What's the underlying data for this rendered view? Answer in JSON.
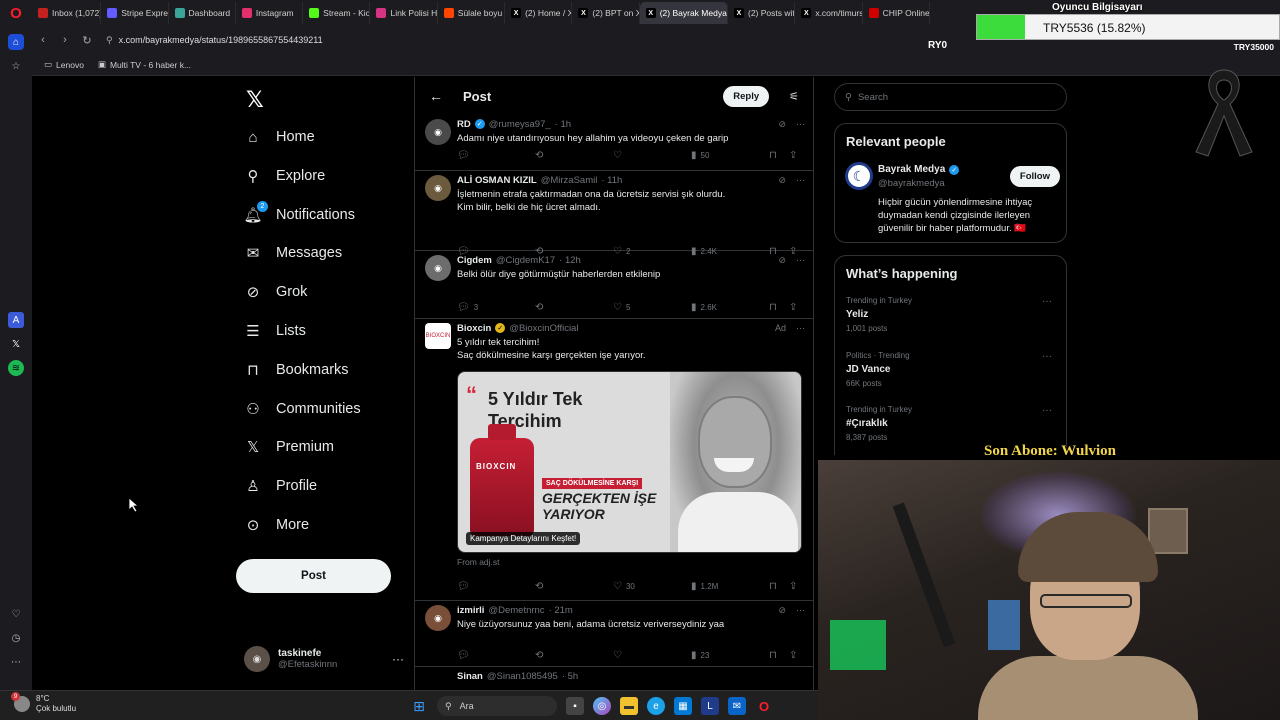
{
  "browser": {
    "tabs": [
      {
        "label": "Inbox (1,072) -",
        "icon": "gmail-icon",
        "color": "#c5221f"
      },
      {
        "label": "Stripe Express",
        "icon": "stripe-icon",
        "color": "#635bff"
      },
      {
        "label": "Dashboard",
        "icon": "dashboard-icon",
        "color": "#3aa39a"
      },
      {
        "label": "Instagram",
        "icon": "instagram-icon",
        "color": "#e1306c"
      },
      {
        "label": "Stream - Kick D",
        "icon": "kick-icon",
        "color": "#53fc18"
      },
      {
        "label": "Link Polisi Hakk",
        "icon": "link-icon",
        "color": "#d63384"
      },
      {
        "label": "Sülale boyu ha",
        "icon": "reddit-icon",
        "color": "#ff4500"
      },
      {
        "label": "(2) Home / X",
        "icon": "x-icon",
        "color": "#000000"
      },
      {
        "label": "(2) BPT on X: \"",
        "icon": "x-icon",
        "color": "#000000"
      },
      {
        "label": "(2) Bayrak Medya on X: \"",
        "icon": "x-icon",
        "color": "#000000"
      },
      {
        "label": "(2) Posts with",
        "icon": "x-icon",
        "color": "#000000"
      },
      {
        "label": "x.com/timursu",
        "icon": "x-icon",
        "color": "#000000"
      },
      {
        "label": "CHIP Online",
        "icon": "chip-icon",
        "color": "#d00000"
      }
    ],
    "active_tab_index": 9,
    "url": "x.com/bayrakmedya/status/1989655867554439211",
    "bookmarks": [
      {
        "label": "Lenovo",
        "icon": "folder-icon"
      },
      {
        "label": "Multi TV - 6 haber k...",
        "icon": "tv-icon"
      }
    ]
  },
  "nav": {
    "items": [
      {
        "label": "Home",
        "icon": "home-icon"
      },
      {
        "label": "Explore",
        "icon": "search-icon"
      },
      {
        "label": "Notifications",
        "icon": "bell-icon",
        "badge": "2"
      },
      {
        "label": "Messages",
        "icon": "mail-icon"
      },
      {
        "label": "Grok",
        "icon": "grok-icon"
      },
      {
        "label": "Lists",
        "icon": "list-icon"
      },
      {
        "label": "Bookmarks",
        "icon": "bookmark-icon"
      },
      {
        "label": "Communities",
        "icon": "communities-icon"
      },
      {
        "label": "Premium",
        "icon": "x-premium-icon"
      },
      {
        "label": "Profile",
        "icon": "person-icon"
      },
      {
        "label": "More",
        "icon": "more-circle-icon"
      }
    ],
    "post_button": "Post",
    "account": {
      "name": "taskinefe",
      "handle": "@Efetaskinnn"
    }
  },
  "feed": {
    "header_title": "Post",
    "reply_button": "Reply",
    "tweets": [
      {
        "name": "RD",
        "verified": "blue",
        "handle": "@rumeysa97_",
        "time": "· 1h",
        "text": "Adamı niye utandırıyosun hey allahim ya videoyu çeken de garip",
        "replies": "",
        "retweets": "",
        "likes": "",
        "views": "50"
      },
      {
        "name": "ALİ OSMAN KIZIL",
        "verified": "",
        "handle": "@MirzaSamil",
        "time": "· 11h",
        "text": "İşletmenin etrafa çaktırmadan ona da ücretsiz servisi şık olurdu.\nKim bilir, belki de hiç ücret almadı.",
        "replies": "",
        "retweets": "",
        "likes": "2",
        "views": "2.4K"
      },
      {
        "name": "Cigdem",
        "verified": "",
        "handle": "@CigdemK17",
        "time": "· 12h",
        "text": "Belki ölür diye götürmüştür haberlerden etkilenip",
        "replies": "3",
        "retweets": "",
        "likes": "5",
        "views": "2.6K"
      },
      {
        "name": "izmirli",
        "verified": "",
        "handle": "@Demetnrnc",
        "time": "· 21m",
        "text": "Niye üzüyorsunuz yaa beni, adama ücretsiz veriverseydiniz yaa",
        "replies": "",
        "retweets": "",
        "likes": "",
        "views": "23"
      }
    ],
    "ad": {
      "name": "Bioxcin",
      "handle": "@BioxcinOfficial",
      "ad_label": "Ad",
      "text_line1": "5 yıldır tek tercihim!",
      "text_line2": "Saç dökülmesine karşı gerçekten işe yarıyor.",
      "image_headline": "5 Yıldır Tek Tercihim",
      "image_brand": "BIOXCIN",
      "image_tag": "SAÇ DÖKÜLMESİNE KARŞI",
      "image_claim": "GERÇEKTEN İŞE YARIYOR",
      "image_cta": "Kampanya Detaylarını Keşfet!",
      "from": "From adj.st",
      "replies": "",
      "retweets": "",
      "likes": "30",
      "views": "1.2M"
    },
    "partial_tweet": {
      "name": "Sinan",
      "handle": "@Sinan1085495",
      "time": "· 5h"
    }
  },
  "right": {
    "search_placeholder": "Search",
    "relevant_title": "Relevant people",
    "relevant": {
      "name": "Bayrak Medya",
      "handle": "@bayrakmedya",
      "follow_button": "Follow",
      "bio": "Hiçbir gücün yönlendirmesine ihtiyaç duymadan kendi çizgisinde ilerleyen güvenilir bir haber platformudur. 🇹🇷"
    },
    "happening_title": "What’s happening",
    "trends": [
      {
        "meta": "Trending in Turkey",
        "title": "Yeliz",
        "count": "1,001 posts"
      },
      {
        "meta": "Politics · Trending",
        "title": "JD Vance",
        "count": "66K posts"
      },
      {
        "meta": "Trending in Turkey",
        "title": "#Çıraklık",
        "count": "8,387 posts"
      }
    ]
  },
  "overlay": {
    "title": "Oyuncu Bilgisayarı",
    "progress_text": "TRY5536 (15.82%)",
    "progress_fraction": 0.1582,
    "left_label": "RY0",
    "right_label": "TRY35000",
    "subscriber": "Son Abone: Wulvion",
    "colors": {
      "progress": "#3bdc3b",
      "subscriber": "#f2d64a"
    }
  },
  "taskbar": {
    "temperature": "8°C",
    "weather": "Çok bulutlu",
    "weather_badge": "9",
    "search_label": "Ara"
  },
  "colors": {
    "accent": "#1d9bf0",
    "bg": "#000000",
    "border": "#2f3336",
    "text": "#e7e9ea",
    "muted": "#71767b"
  }
}
